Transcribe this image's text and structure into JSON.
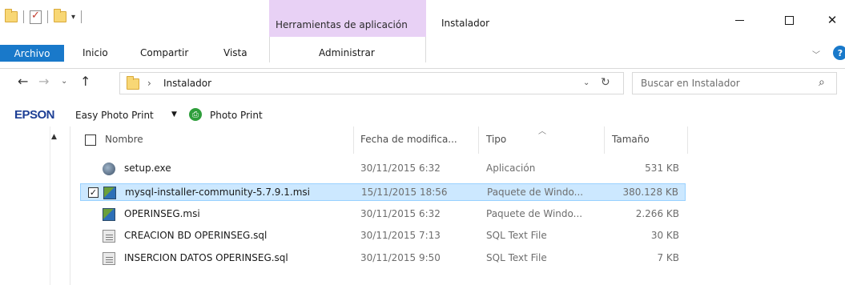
{
  "titlebar": {
    "app_tools_label": "Herramientas de aplicación",
    "window_title": "Instalador",
    "minimize_glyph": "—",
    "maximize_glyph": "☐",
    "close_glyph": "✕"
  },
  "ribbon": {
    "tabs": {
      "archivo": "Archivo",
      "inicio": "Inicio",
      "compartir": "Compartir",
      "vista": "Vista",
      "administrar": "Administrar"
    },
    "accent_color": "#1979ca",
    "context_tab_color": "#e8d1f5"
  },
  "nav": {
    "back": "←",
    "forward": "→",
    "recent": "⌄",
    "up": "↑",
    "address_path": "Instalador",
    "address_chevron": "›",
    "address_dropdown": "⌄",
    "refresh": "↻",
    "search_placeholder": "Buscar en Instalador",
    "search_icon": "⌕"
  },
  "epson_toolbar": {
    "logo": "EPSON",
    "easy_photo_print": "Easy Photo Print",
    "dropdown": "▼",
    "photo_print": "Photo Print"
  },
  "columns": {
    "name": "Nombre",
    "date": "Fecha de modifica...",
    "type": "Tipo",
    "size": "Tamaño"
  },
  "files": [
    {
      "icon": "exe-icon",
      "name": "setup.exe",
      "date": "30/11/2015 6:32",
      "type": "Aplicación",
      "size": "531 KB",
      "selected": false
    },
    {
      "icon": "msi-icon",
      "name": "mysql-installer-community-5.7.9.1.msi",
      "date": "15/11/2015 18:56",
      "type": "Paquete de Windo...",
      "size": "380.128 KB",
      "selected": true
    },
    {
      "icon": "msi-icon",
      "name": "OPERINSEG.msi",
      "date": "30/11/2015 6:32",
      "type": "Paquete de Windo...",
      "size": "2.266 KB",
      "selected": false
    },
    {
      "icon": "sql-icon",
      "name": "CREACION BD OPERINSEG.sql",
      "date": "30/11/2015 7:13",
      "type": "SQL Text File",
      "size": "30 KB",
      "selected": false
    },
    {
      "icon": "sql-icon",
      "name": "INSERCION DATOS OPERINSEG.sql",
      "date": "30/11/2015 9:50",
      "type": "SQL Text File",
      "size": "7 KB",
      "selected": false
    }
  ]
}
